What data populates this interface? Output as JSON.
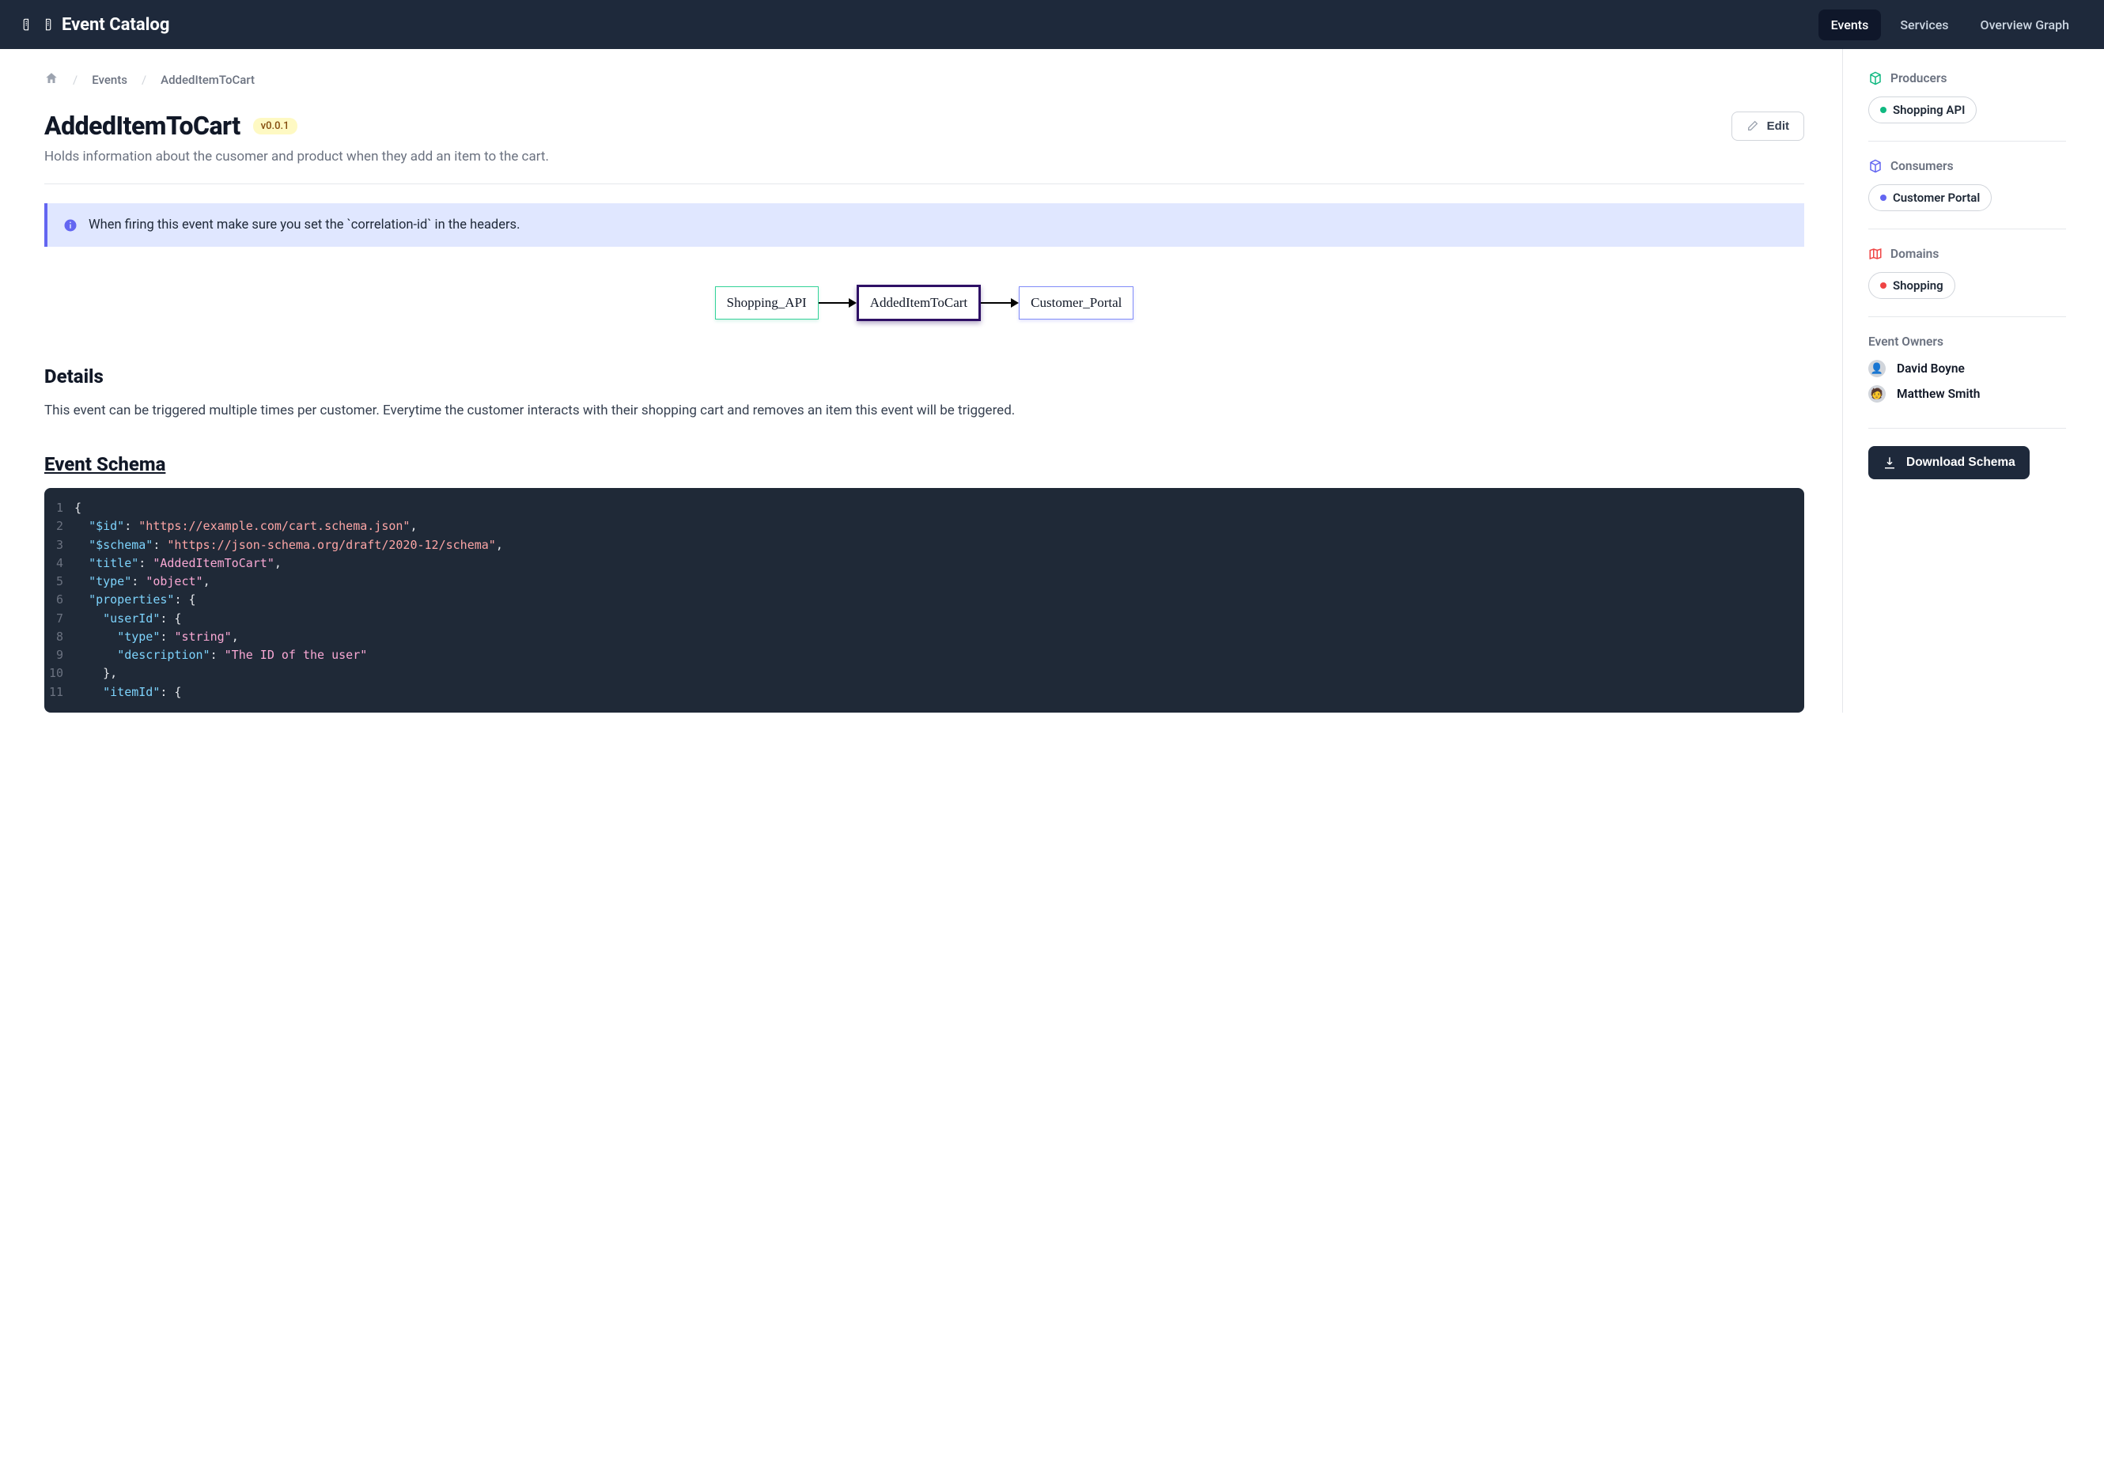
{
  "nav": {
    "brand": "Event Catalog",
    "links": {
      "events": "Events",
      "services": "Services",
      "overview": "Overview Graph"
    }
  },
  "breadcrumbs": {
    "events": "Events",
    "current": "AddedItemToCart"
  },
  "title": "AddedItemToCart",
  "version": "v0.0.1",
  "edit_label": "Edit",
  "subtitle": "Holds information about the cusomer and product when they add an item to the cart.",
  "callout": "When firing this event make sure you set the `correlation-id` in the headers.",
  "flow": {
    "producer": "Shopping_API",
    "event": "AddedItemToCart",
    "consumer": "Customer_Portal"
  },
  "details": {
    "heading": "Details",
    "text": "This event can be triggered multiple times per customer. Everytime the customer interacts with their shopping cart and removes an item this event will be triggered."
  },
  "schema": {
    "heading": "Event Schema",
    "lines": [
      [
        {
          "t": "punc",
          "v": "{"
        }
      ],
      [
        {
          "t": "pad",
          "v": "  "
        },
        {
          "t": "key",
          "v": "\"$id\""
        },
        {
          "t": "punc",
          "v": ": "
        },
        {
          "t": "str",
          "v": "\"https://example.com/cart.schema.json\""
        },
        {
          "t": "punc",
          "v": ","
        }
      ],
      [
        {
          "t": "pad",
          "v": "  "
        },
        {
          "t": "key",
          "v": "\"$schema\""
        },
        {
          "t": "punc",
          "v": ": "
        },
        {
          "t": "str",
          "v": "\"https://json-schema.org/draft/2020-12/schema\""
        },
        {
          "t": "punc",
          "v": ","
        }
      ],
      [
        {
          "t": "pad",
          "v": "  "
        },
        {
          "t": "key",
          "v": "\"title\""
        },
        {
          "t": "punc",
          "v": ": "
        },
        {
          "t": "str2",
          "v": "\"AddedItemToCart\""
        },
        {
          "t": "punc",
          "v": ","
        }
      ],
      [
        {
          "t": "pad",
          "v": "  "
        },
        {
          "t": "key",
          "v": "\"type\""
        },
        {
          "t": "punc",
          "v": ": "
        },
        {
          "t": "str2",
          "v": "\"object\""
        },
        {
          "t": "punc",
          "v": ","
        }
      ],
      [
        {
          "t": "pad",
          "v": "  "
        },
        {
          "t": "key",
          "v": "\"properties\""
        },
        {
          "t": "punc",
          "v": ": {"
        }
      ],
      [
        {
          "t": "pad",
          "v": "    "
        },
        {
          "t": "key",
          "v": "\"userId\""
        },
        {
          "t": "punc",
          "v": ": {"
        }
      ],
      [
        {
          "t": "pad",
          "v": "      "
        },
        {
          "t": "key",
          "v": "\"type\""
        },
        {
          "t": "punc",
          "v": ": "
        },
        {
          "t": "str2",
          "v": "\"string\""
        },
        {
          "t": "punc",
          "v": ","
        }
      ],
      [
        {
          "t": "pad",
          "v": "      "
        },
        {
          "t": "key",
          "v": "\"description\""
        },
        {
          "t": "punc",
          "v": ": "
        },
        {
          "t": "str2",
          "v": "\"The ID of the user\""
        }
      ],
      [
        {
          "t": "pad",
          "v": "    "
        },
        {
          "t": "punc",
          "v": "},"
        }
      ],
      [
        {
          "t": "pad",
          "v": "    "
        },
        {
          "t": "key",
          "v": "\"itemId\""
        },
        {
          "t": "punc",
          "v": ": {"
        }
      ]
    ]
  },
  "sidebar": {
    "producers": {
      "heading": "Producers",
      "items": [
        "Shopping API"
      ]
    },
    "consumers": {
      "heading": "Consumers",
      "items": [
        "Customer Portal"
      ]
    },
    "domains": {
      "heading": "Domains",
      "items": [
        "Shopping"
      ]
    },
    "owners": {
      "heading": "Event Owners",
      "people": [
        "David Boyne",
        "Matthew Smith"
      ]
    },
    "download": "Download Schema"
  }
}
